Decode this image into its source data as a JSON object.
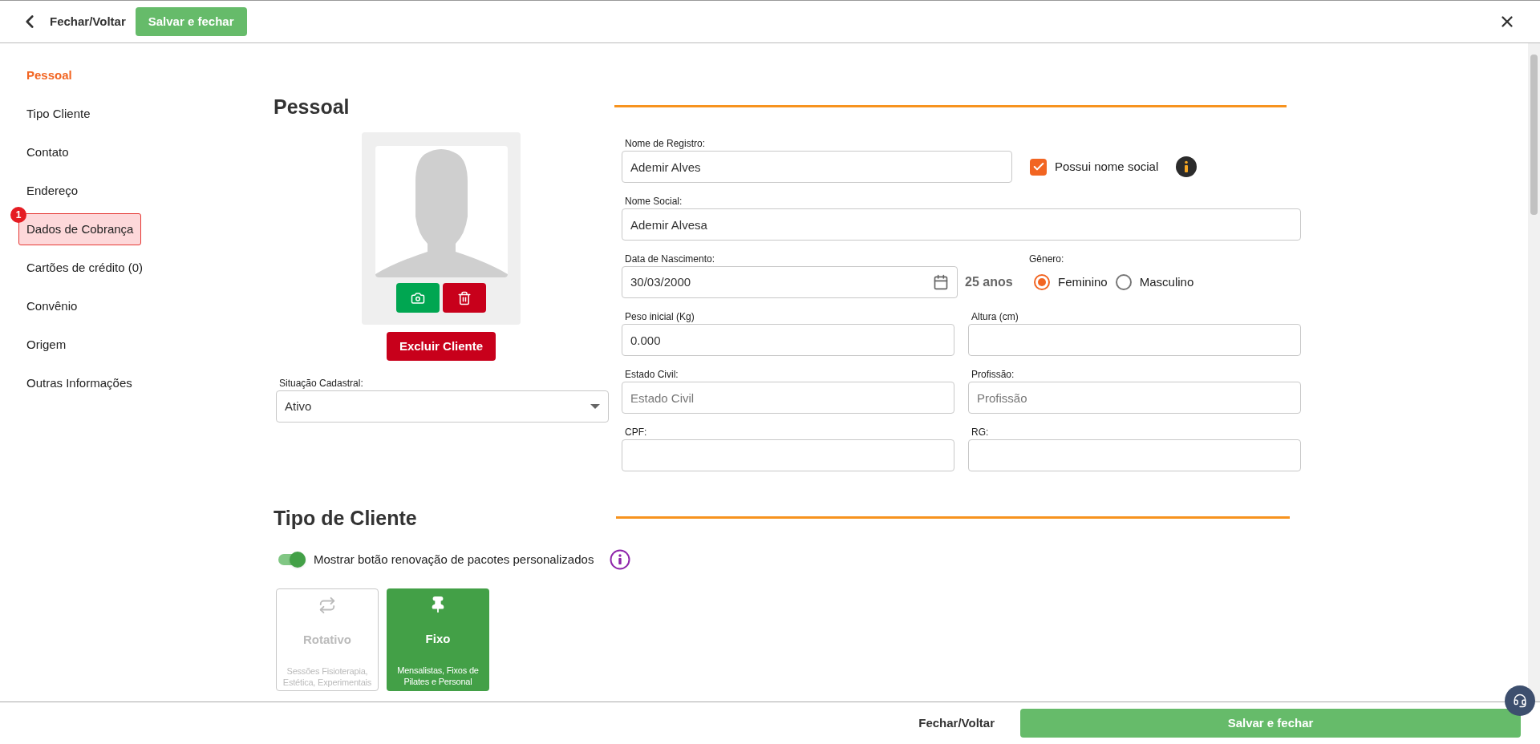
{
  "header": {
    "back_label": "Fechar/Voltar",
    "save_label": "Salvar e fechar"
  },
  "sidebar": {
    "items": [
      {
        "label": "Pessoal",
        "selected": true,
        "error": false
      },
      {
        "label": "Tipo Cliente",
        "selected": false,
        "error": false
      },
      {
        "label": "Contato",
        "selected": false,
        "error": false
      },
      {
        "label": "Endereço",
        "selected": false,
        "error": false
      },
      {
        "label": "Dados de Cobrança",
        "selected": false,
        "error": true,
        "badge": "1"
      },
      {
        "label": "Cartões de crédito (0)",
        "selected": false,
        "error": false
      },
      {
        "label": "Convênio",
        "selected": false,
        "error": false
      },
      {
        "label": "Origem",
        "selected": false,
        "error": false
      },
      {
        "label": "Outras Informações",
        "selected": false,
        "error": false
      }
    ]
  },
  "pessoal": {
    "title": "Pessoal",
    "delete_client_label": "Excluir Cliente",
    "status": {
      "label": "Situação Cadastral:",
      "value": "Ativo"
    },
    "nome_registro": {
      "label": "Nome de Registro:",
      "value": "Ademir Alves"
    },
    "possui_nome_social": {
      "label": "Possui nome social",
      "checked": true
    },
    "nome_social": {
      "label": "Nome Social:",
      "value": "Ademir Alvesa"
    },
    "data_nascimento": {
      "label": "Data de Nascimento:",
      "value": "30/03/2000"
    },
    "age": "25 anos",
    "genero": {
      "label": "Gênero:",
      "options": [
        {
          "label": "Feminino",
          "selected": true
        },
        {
          "label": "Masculino",
          "selected": false
        }
      ]
    },
    "peso": {
      "label": "Peso inicial (Kg)",
      "value": "0.000"
    },
    "altura": {
      "label": "Altura (cm)"
    },
    "estado_civil": {
      "label": "Estado Civil:",
      "placeholder": "Estado Civil"
    },
    "profissao": {
      "label": "Profissão:",
      "placeholder": "Profissão"
    },
    "cpf": {
      "label": "CPF:"
    },
    "rg": {
      "label": "RG:"
    }
  },
  "tipo_cliente": {
    "title": "Tipo de Cliente",
    "toggle": {
      "label": "Mostrar botão renovação de pacotes personalizados",
      "on": true
    },
    "options": [
      {
        "kind": "rotativo",
        "title": "Rotativo",
        "description": "Sessões Fisioterapia, Estética, Experimentais",
        "selected": false
      },
      {
        "kind": "fixo",
        "title": "Fixo",
        "description": "Mensalistas, Fixos de Pilates e Personal",
        "selected": true
      }
    ]
  },
  "footer": {
    "back_label": "Fechar/Voltar",
    "save_label": "Salvar e fechar"
  }
}
